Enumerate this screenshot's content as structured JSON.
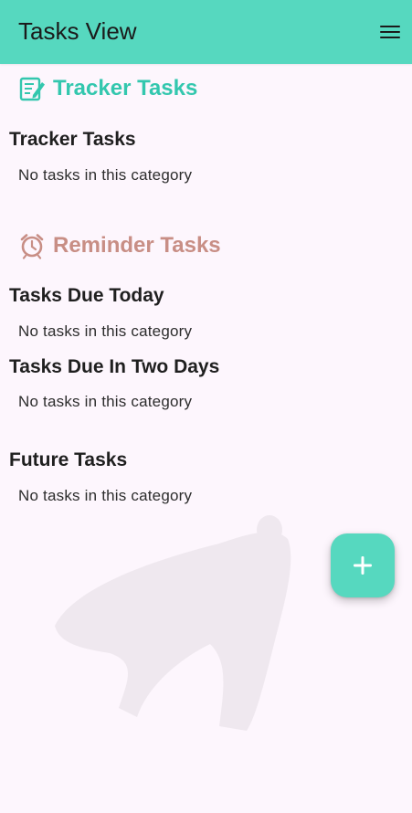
{
  "appbar": {
    "title": "Tasks View",
    "menu_icon": "hamburger-menu-icon",
    "background_color": "#56d8bf"
  },
  "tracker_section": {
    "header": "Tracker Tasks",
    "icon": "notepad-edit-icon",
    "color": "#33c7ae",
    "categories": [
      {
        "title": "Tracker Tasks",
        "empty_message": "No tasks in this category"
      }
    ]
  },
  "reminder_section": {
    "header": "Reminder Tasks",
    "icon": "alarm-clock-icon",
    "color": "#c88e85",
    "categories": [
      {
        "title": "Tasks Due Today",
        "empty_message": "No tasks in this category"
      },
      {
        "title": "Tasks Due In Two Days",
        "empty_message": "No tasks in this category"
      },
      {
        "title": "Future Tasks",
        "empty_message": "No tasks in this category"
      }
    ]
  },
  "fab": {
    "icon": "plus-icon",
    "color": "#56d8bf"
  },
  "background": {
    "color": "#fdf6fd"
  }
}
